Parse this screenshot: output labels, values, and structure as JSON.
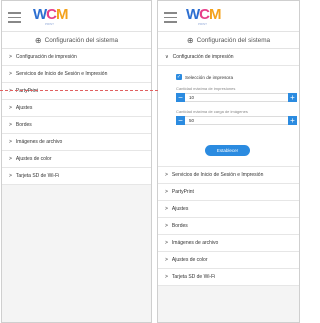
{
  "logo": {
    "w": "W",
    "c": "C",
    "m": "M",
    "sub": "PRINT"
  },
  "title": "Configuración del sistema",
  "left_menu": [
    "Configuración de impresión",
    "Servicios de Inicio de Sesión e Impresión",
    "PartyPrint",
    "Ajustes",
    "Bordes",
    "Imágenes de archivo",
    "Ajustes de color",
    "Tarjeta SD de Wi-Fi"
  ],
  "right": {
    "expanded_label": "Configuración de impresión",
    "checkbox_label": "Selección de impresora",
    "field1_label": "Cantidad máxima de impresiones",
    "field1_value": "10",
    "field2_label": "Cantidad máxima de carga de imágenes",
    "field2_value": "50",
    "set_button": "Establecer",
    "menu": [
      "Servicios de Inicio de Sesión e Impresión",
      "PartyPrint",
      "Ajustes",
      "Bordes",
      "Imágenes de archivo",
      "Ajustes de color",
      "Tarjeta SD de Wi-Fi"
    ]
  }
}
